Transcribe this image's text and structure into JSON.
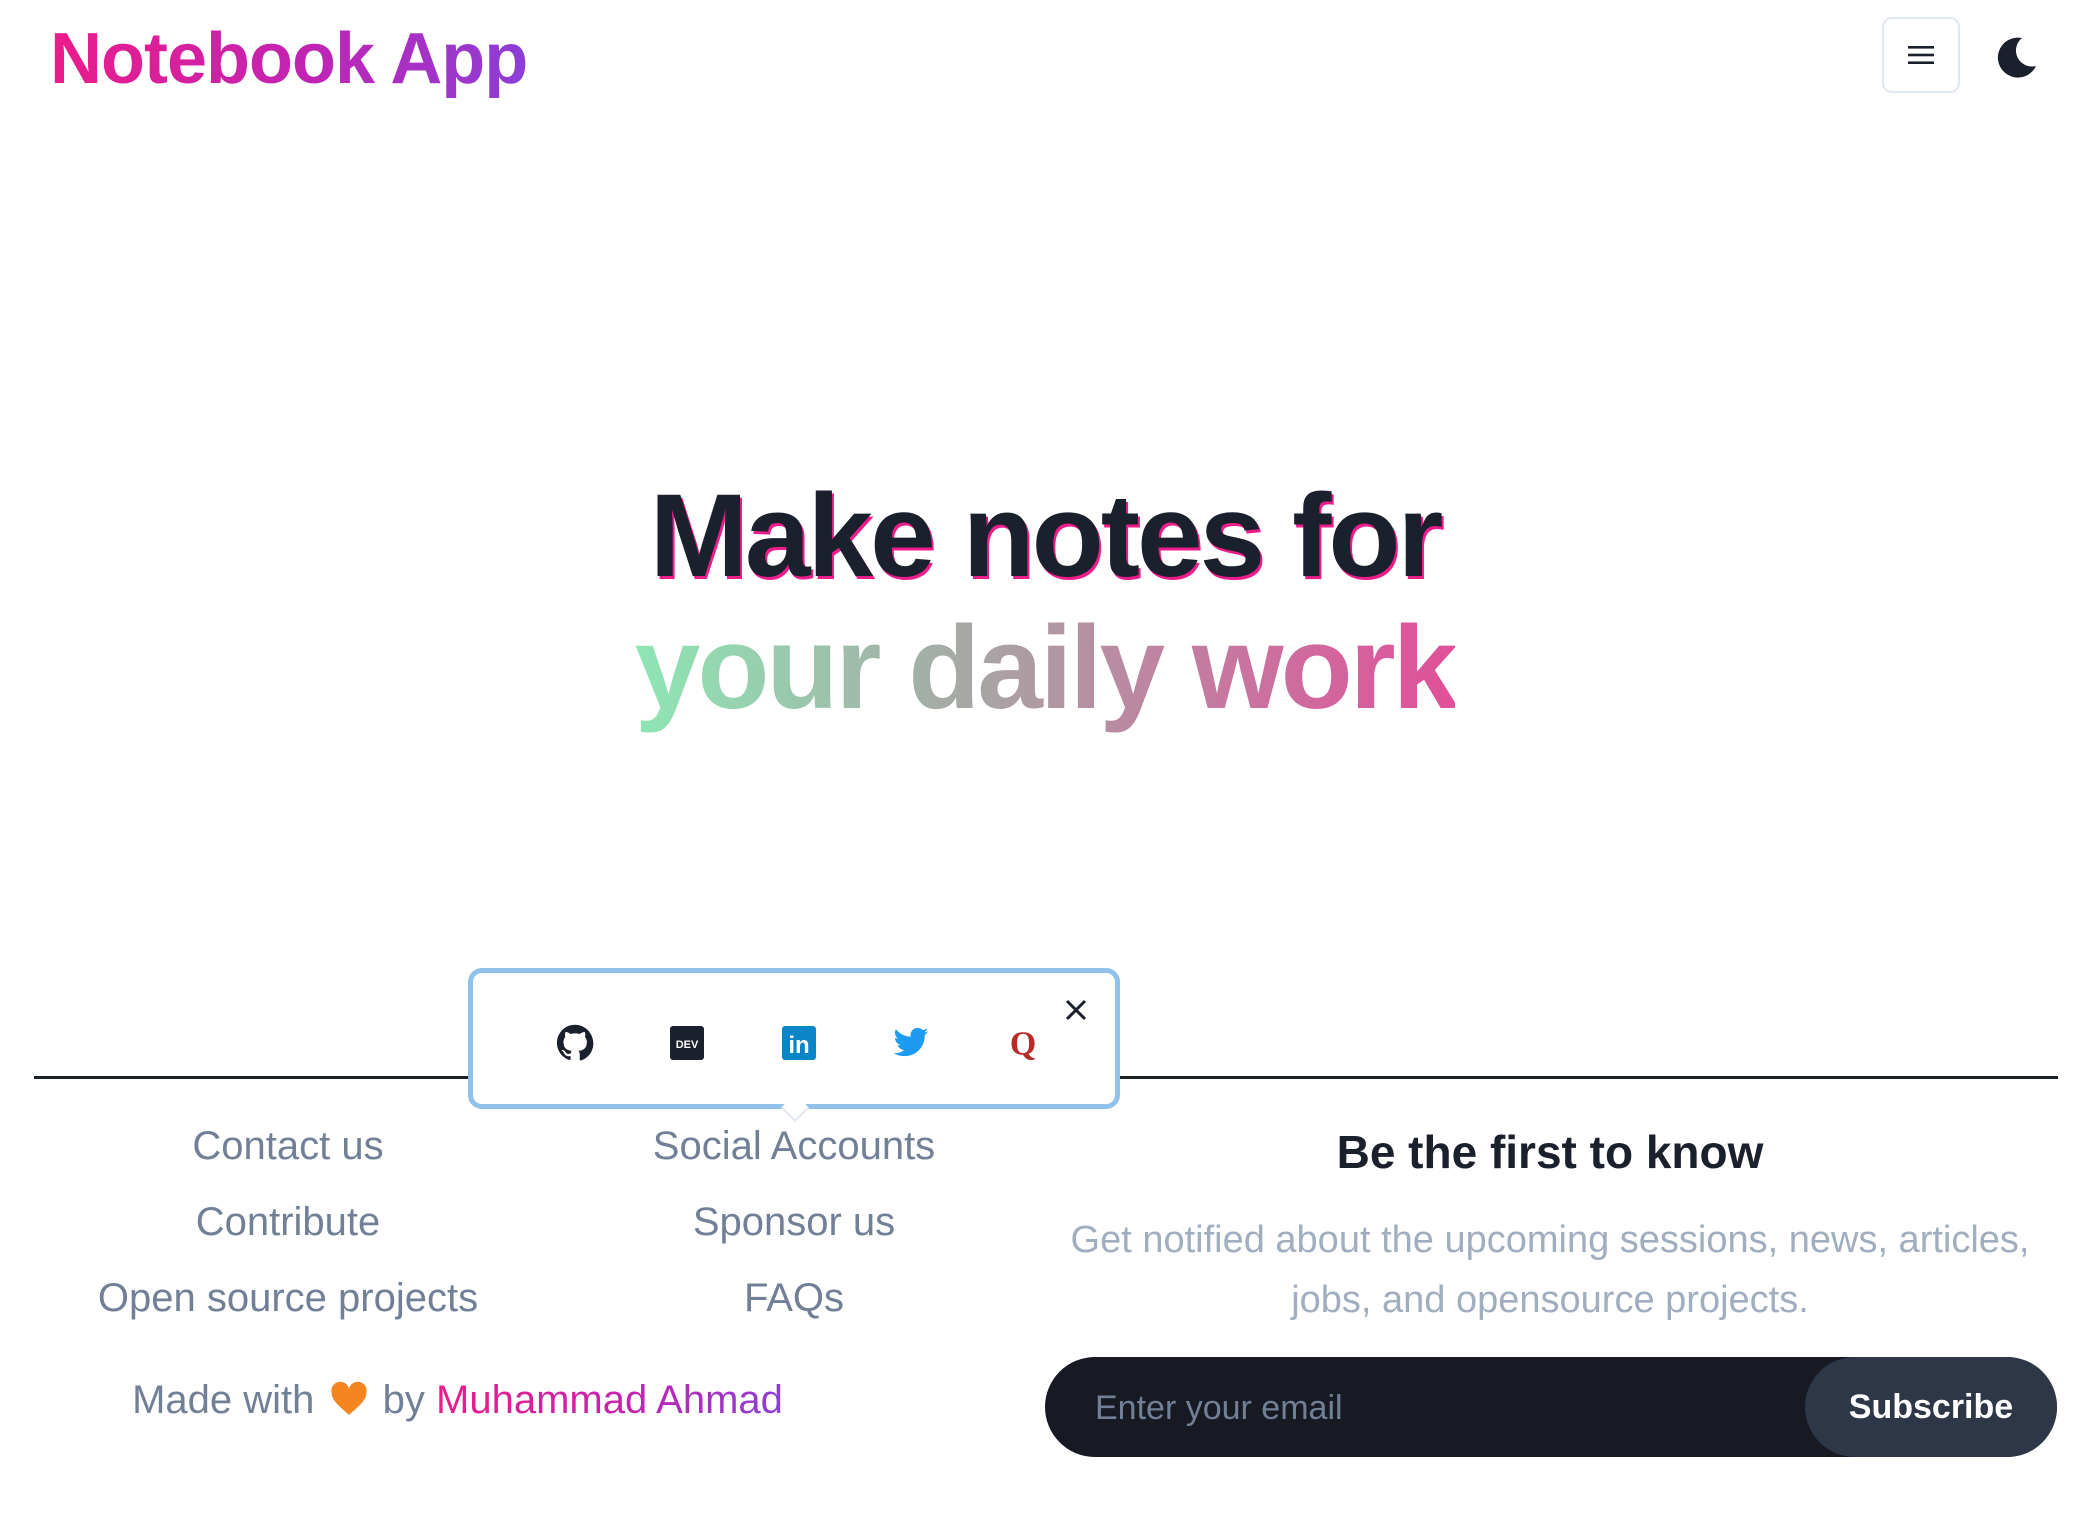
{
  "header": {
    "brand": "Notebook App",
    "menu_icon": "hamburger-icon",
    "theme_icon": "moon-icon"
  },
  "hero": {
    "line1": "Make notes for",
    "line2": "your daily work"
  },
  "social_popover": {
    "items": [
      {
        "name": "github",
        "icon": "github-icon",
        "color": "#1a202c"
      },
      {
        "name": "dev",
        "icon": "dev-icon",
        "color": "#1a202c",
        "text": "DEV"
      },
      {
        "name": "linkedin",
        "icon": "linkedin-icon",
        "color": "#0a86c8",
        "text": "in"
      },
      {
        "name": "twitter",
        "icon": "twitter-icon",
        "color": "#1d9bf0"
      },
      {
        "name": "quora",
        "icon": "quora-icon",
        "color": "#b92b27",
        "text": "Q"
      }
    ],
    "close_icon": "close-icon"
  },
  "footer": {
    "col1": [
      "Contact us",
      "Contribute",
      "Open source projects"
    ],
    "col2": [
      "Social Accounts",
      "Sponsor us",
      "FAQs"
    ],
    "made_with_prefix": "Made with",
    "made_with_by": "by",
    "author": "Muhammad Ahmad",
    "heart_icon": "orange-heart-icon"
  },
  "newsletter": {
    "title": "Be the first to know",
    "text_line1": "Get notified about the upcoming sessions, news, articles,",
    "text_line2": "jobs, and opensource projects.",
    "email_placeholder": "Enter your email",
    "email_value": "",
    "subscribe_label": "Subscribe"
  },
  "colors": {
    "brand_pink": "#ec1c8a",
    "brand_purple": "#8b3fd6",
    "dark": "#171923",
    "muted": "#718096"
  }
}
